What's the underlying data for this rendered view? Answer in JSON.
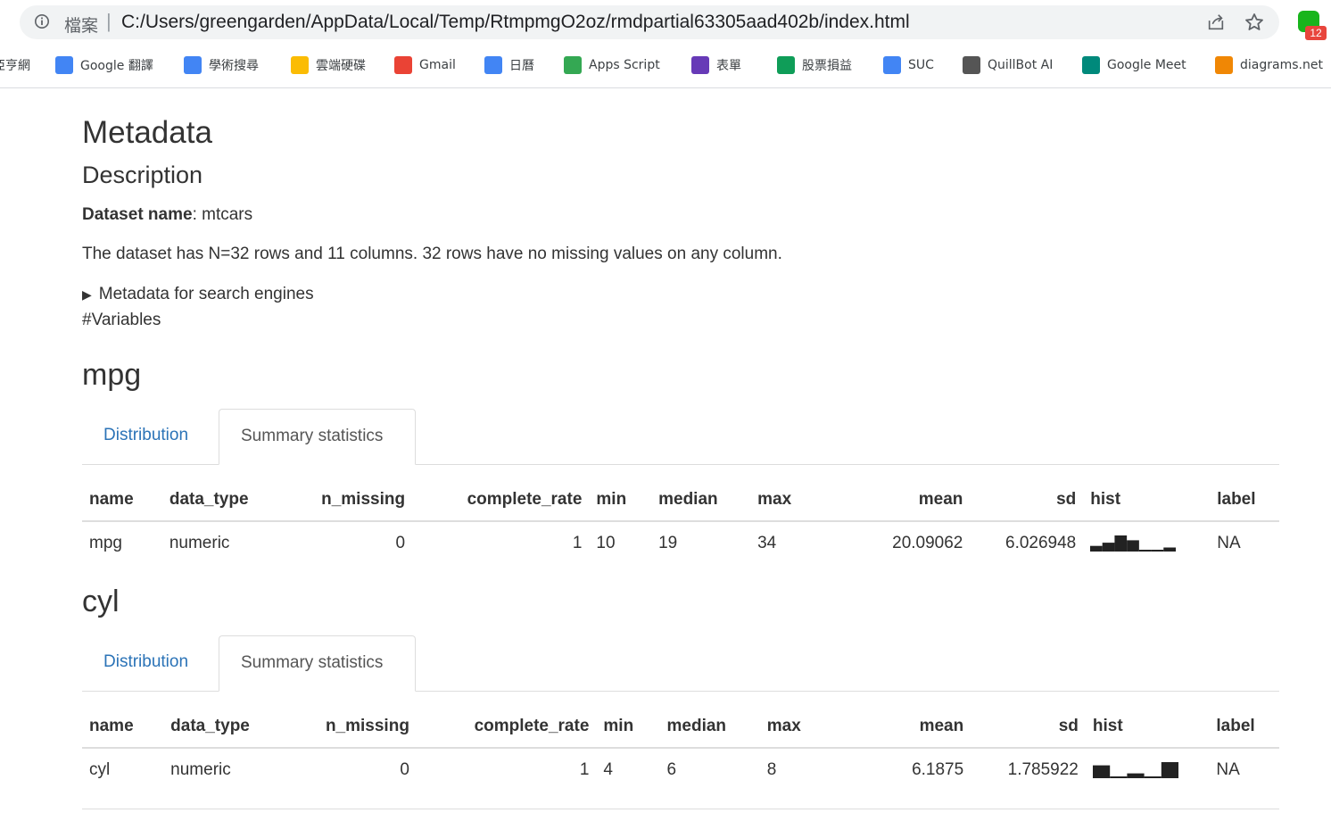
{
  "browser": {
    "scheme_label": "檔案",
    "url": "C:/Users/greengarden/AppData/Local/Temp/RtmpmgO2oz/rmdpartial63305aad402b/index.html",
    "extension_badge": "12",
    "bookmarks": [
      {
        "label": "亞亨網",
        "icon": "generic-icon",
        "color": "#888888"
      },
      {
        "label": "Google 翻譯",
        "icon": "google-translate-icon",
        "color": "#4285f4"
      },
      {
        "label": "學術搜尋",
        "icon": "scholar-icon",
        "color": "#4285f4"
      },
      {
        "label": "雲端硬碟",
        "icon": "drive-icon",
        "color": "#fbbc04"
      },
      {
        "label": "Gmail",
        "icon": "gmail-icon",
        "color": "#ea4335"
      },
      {
        "label": "日曆",
        "icon": "calendar-icon",
        "color": "#4285f4"
      },
      {
        "label": "Apps Script",
        "icon": "apps-script-icon",
        "color": "#34a853"
      },
      {
        "label": "表單",
        "icon": "forms-icon",
        "color": "#673ab7"
      },
      {
        "label": "股票損益",
        "icon": "sheets-icon",
        "color": "#0f9d58"
      },
      {
        "label": "SUC",
        "icon": "docs-icon",
        "color": "#4285f4"
      },
      {
        "label": "QuillBot AI",
        "icon": "quill-icon",
        "color": "#555555"
      },
      {
        "label": "Google Meet",
        "icon": "meet-icon",
        "color": "#00897b"
      },
      {
        "label": "diagrams.net",
        "icon": "diagrams-icon",
        "color": "#f08705"
      }
    ]
  },
  "page": {
    "title": "Metadata",
    "subtitle": "Description",
    "dataset_label": "Dataset name",
    "dataset_value": ": mtcars",
    "summary": "The dataset has N=32 rows and 11 columns. 32 rows have no missing values on any column.",
    "details_label": "Metadata for search engines",
    "variables_heading": "#Variables"
  },
  "variables": [
    {
      "heading": "mpg",
      "tab_distribution": "Distribution",
      "tab_summary": "Summary statistics",
      "columns": [
        "name",
        "data_type",
        "n_missing",
        "complete_rate",
        "min",
        "median",
        "max",
        "mean",
        "sd",
        "hist",
        "label"
      ],
      "row": [
        "mpg",
        "numeric",
        "0",
        "1",
        "10",
        "19",
        "34",
        "20.09062",
        "6.026948",
        "",
        "NA"
      ],
      "hist": [
        0.35,
        0.55,
        1.0,
        0.7,
        0.1,
        0.1,
        0.25
      ]
    },
    {
      "heading": "cyl",
      "tab_distribution": "Distribution",
      "tab_summary": "Summary statistics",
      "columns": [
        "name",
        "data_type",
        "n_missing",
        "complete_rate",
        "min",
        "median",
        "max",
        "mean",
        "sd",
        "hist",
        "label"
      ],
      "row": [
        "cyl",
        "numeric",
        "0",
        "1",
        "4",
        "6",
        "8",
        "6.1875",
        "1.785922",
        "",
        "NA"
      ],
      "hist": [
        0.8,
        0.1,
        0.3,
        0.1,
        1.0
      ]
    }
  ]
}
